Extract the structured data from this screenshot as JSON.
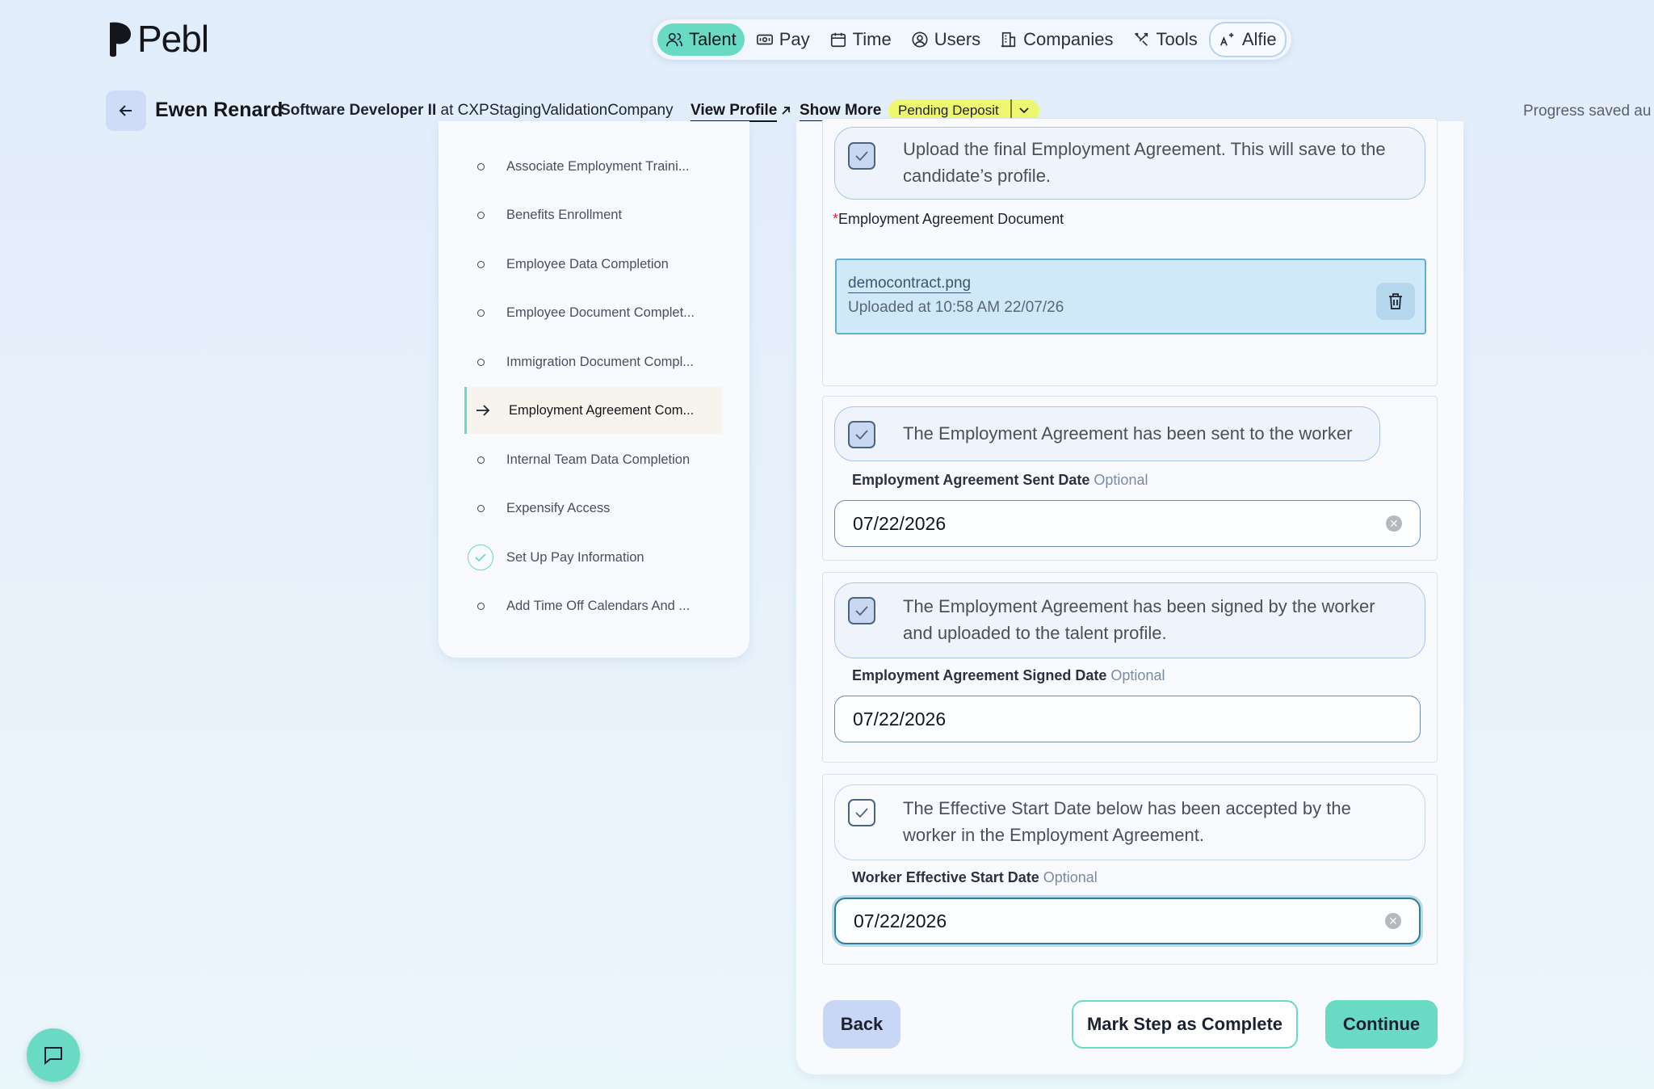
{
  "app": {
    "name": "Pebl"
  },
  "nav": {
    "items": [
      {
        "label": "Talent",
        "icon": "users-icon"
      },
      {
        "label": "Pay",
        "icon": "money-icon"
      },
      {
        "label": "Time",
        "icon": "calendar-icon"
      },
      {
        "label": "Users",
        "icon": "user-circle-icon"
      },
      {
        "label": "Companies",
        "icon": "building-icon"
      },
      {
        "label": "Tools",
        "icon": "tools-icon"
      },
      {
        "label": "Alfie",
        "icon": "sparkle-a-icon"
      }
    ],
    "active": "Talent"
  },
  "header": {
    "name": "Ewen Renard",
    "role": "Software Developer II",
    "at": "at",
    "company": "CXPStagingValidationCompany",
    "view_profile": "View Profile",
    "show_more": "Show More",
    "status": "Pending Deposit",
    "progress": "Progress saved au"
  },
  "steps": [
    {
      "label": "Associate Employment Traini...",
      "state": "todo"
    },
    {
      "label": "Benefits Enrollment",
      "state": "todo"
    },
    {
      "label": "Employee Data Completion",
      "state": "todo"
    },
    {
      "label": "Employee Document Complet...",
      "state": "todo"
    },
    {
      "label": "Immigration Document Compl...",
      "state": "todo"
    },
    {
      "label": "Employment Agreement Com...",
      "state": "current"
    },
    {
      "label": "Internal Team Data Completion",
      "state": "todo"
    },
    {
      "label": "Expensify Access",
      "state": "todo"
    },
    {
      "label": "Set Up Pay Information",
      "state": "done"
    },
    {
      "label": "Add Time Off Calendars And ...",
      "state": "todo"
    }
  ],
  "form": {
    "upload_task": "Upload the final Employment Agreement. This will save to the candidate’s profile.",
    "doc_label_required": "*",
    "doc_label": "Employment Agreement Document",
    "file_name": "democontract.png",
    "file_uploaded": "Uploaded at 10:58 AM 22/07/26",
    "sent_task": "The Employment Agreement has been sent to the worker",
    "sent_label": "Employment Agreement Sent Date",
    "sent_value": "07/22/2026",
    "signed_task": "The Employment Agreement has been signed by the worker and uploaded to the talent profile.",
    "signed_label": "Employment Agreement Signed Date",
    "signed_value": "07/22/2026",
    "start_task": "The Effective Start Date below has been accepted by the worker in the Employment Agreement.",
    "start_label": "Worker Effective Start Date",
    "start_value": "07/22/2026",
    "optional": "Optional"
  },
  "buttons": {
    "back": "Back",
    "mark_complete": "Mark Step as Complete",
    "continue": "Continue"
  },
  "colors": {
    "accent": "#69dac4",
    "status_pill": "#eff76e",
    "upload_bg": "#cfe9f8"
  }
}
